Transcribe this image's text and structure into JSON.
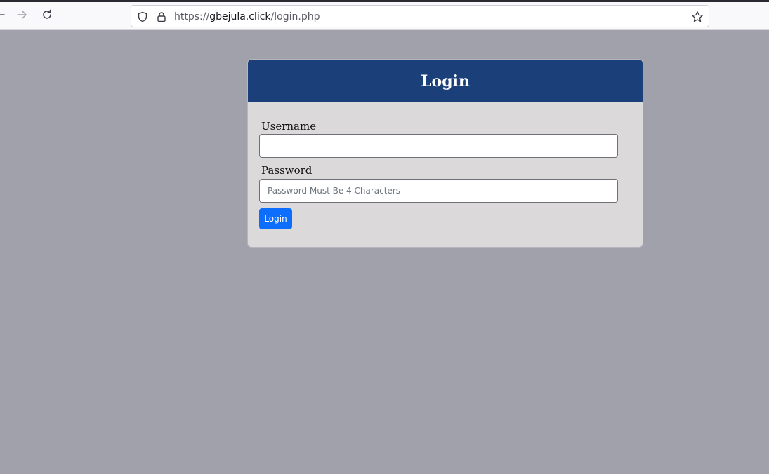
{
  "browser": {
    "url_prefix": "https://",
    "url_host": "gbejula.click",
    "url_path": "/login.php",
    "icons": [
      "back-arrow-icon",
      "forward-arrow-icon",
      "reload-icon",
      "shield-icon",
      "lock-icon",
      "star-icon"
    ]
  },
  "login": {
    "title": "Login",
    "username_label": "Username",
    "username_value": "",
    "password_label": "Password",
    "password_placeholder": "Password Must Be 4 Characters",
    "submit_label": "Login"
  },
  "colors": {
    "page_background": "#a1a1ac",
    "card_header": "#1b3f79",
    "card_body": "#dbd9da",
    "button": "#0d6efd"
  }
}
